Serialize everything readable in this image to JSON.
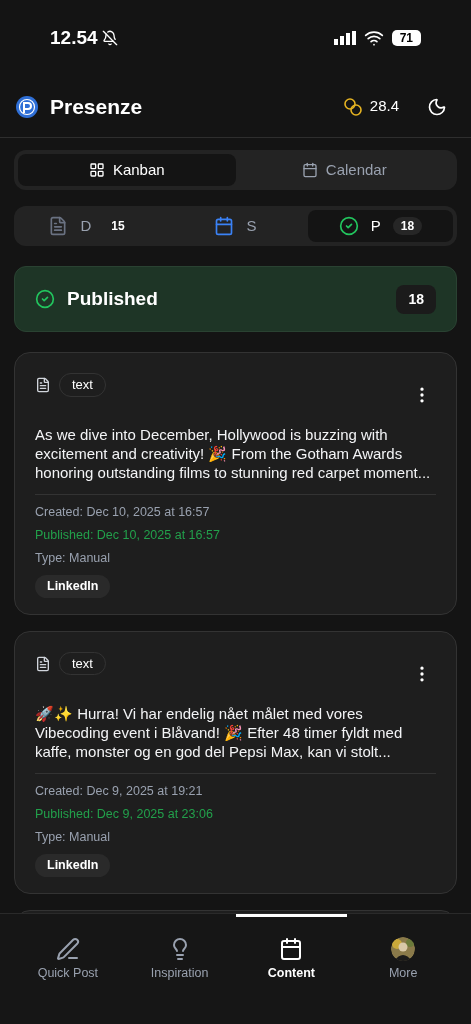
{
  "status_bar": {
    "time": "12.54",
    "muted": true,
    "battery": "71"
  },
  "header": {
    "title": "Presenze",
    "credits": "28.4"
  },
  "view_tabs": [
    {
      "label": "Kanban",
      "kind": "kanban",
      "selected": true
    },
    {
      "label": "Calendar",
      "kind": "calendar",
      "selected": false
    }
  ],
  "status_tabs": [
    {
      "label": "D",
      "kind": "draft",
      "count": "15",
      "selected": false
    },
    {
      "label": "S",
      "kind": "scheduled",
      "selected": false
    },
    {
      "label": "P",
      "kind": "published",
      "count": "18",
      "selected": true
    }
  ],
  "column": {
    "title": "Published",
    "count": "18"
  },
  "cards": [
    {
      "type": "text",
      "body": "As we dive into December, Hollywood is buzzing with excitement and creativity! 🎉 From the Gotham Awards honoring outstanding films to stunning red carpet moment...",
      "meta": [
        {
          "kind": "created",
          "text": "Created: Dec 10, 2025 at 16:57"
        },
        {
          "kind": "published",
          "text": "Published: Dec 10, 2025 at 16:57"
        },
        {
          "kind": "type",
          "text": "Type: Manual"
        }
      ],
      "platform": "LinkedIn"
    },
    {
      "type": "text",
      "body": "🚀✨ Hurra! Vi har endelig nået målet med vores Vibecoding event i Blåvand! 🎉 Efter 48 timer fyldt med kaffe, monster og en god del Pepsi Max, kan vi stolt...",
      "meta": [
        {
          "kind": "created",
          "text": "Created: Dec 9, 2025 at 19:21"
        },
        {
          "kind": "published",
          "text": "Published: Dec 9, 2025 at 23:06"
        },
        {
          "kind": "type",
          "text": "Type: Manual"
        }
      ],
      "platform": "LinkedIn"
    }
  ],
  "bottom_nav": [
    {
      "label": "Quick Post",
      "kind": "pen",
      "selected": false
    },
    {
      "label": "Inspiration",
      "kind": "bulb",
      "selected": false
    },
    {
      "label": "Content",
      "kind": "calendar",
      "selected": true
    },
    {
      "label": "More",
      "kind": "avatar",
      "selected": false
    }
  ]
}
